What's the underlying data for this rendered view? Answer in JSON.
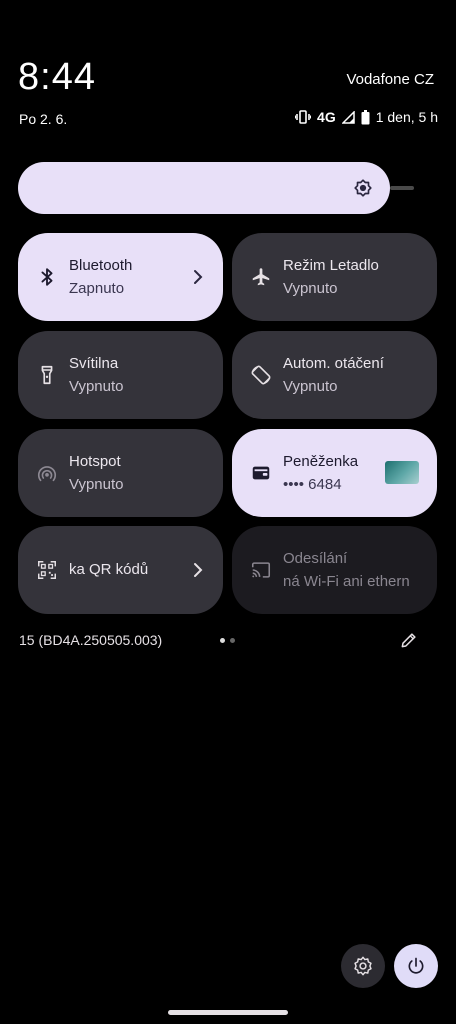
{
  "status_bar": {
    "time": "8:44",
    "carrier": "Vodafone CZ",
    "date": "Po 2. 6.",
    "network": "4G",
    "battery_text": "1 den, 5 h"
  },
  "brightness": {
    "level": 0.95
  },
  "tiles": [
    {
      "title": "Bluetooth",
      "subtitle": "Zapnuto",
      "icon": "bluetooth-icon",
      "state": "on"
    },
    {
      "title": "Režim Letadlo",
      "subtitle": "Vypnuto",
      "icon": "airplane-icon",
      "state": "off"
    },
    {
      "title": "Svítilna",
      "subtitle": "Vypnuto",
      "icon": "flashlight-icon",
      "state": "off"
    },
    {
      "title": "Autom. otáčení",
      "subtitle": "Vypnuto",
      "icon": "auto-rotate-icon",
      "state": "off"
    },
    {
      "title": "Hotspot",
      "subtitle": "Vypnuto",
      "icon": "hotspot-icon",
      "state": "off"
    },
    {
      "title": "Peněženka",
      "subtitle": "•••• 6484",
      "icon": "wallet-icon",
      "state": "on"
    },
    {
      "title": "ka QR kódů",
      "subtitle": "",
      "icon": "qr-code-icon",
      "state": "off"
    },
    {
      "title": "Odesílání",
      "subtitle": "ná Wi-Fi ani ethern",
      "icon": "cast-icon",
      "state": "unavailable"
    }
  ],
  "footer": {
    "build": "15 (BD4A.250505.003)",
    "page_index": 1,
    "page_count": 2
  },
  "colors": {
    "active_tile": "#e8e0f8",
    "inactive_tile": "#34333a",
    "background": "#000000"
  }
}
